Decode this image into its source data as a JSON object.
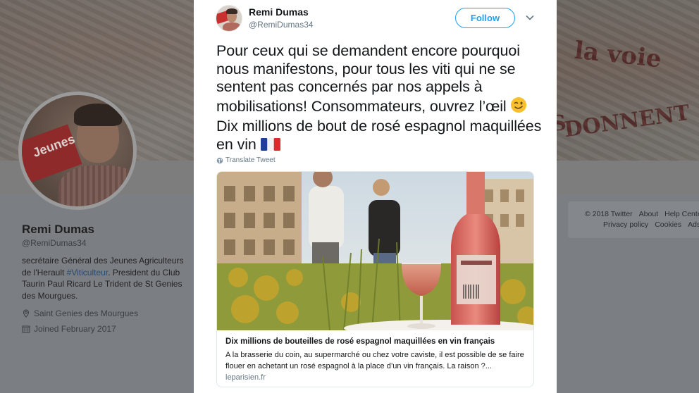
{
  "background_profile": {
    "banner_words": [
      "la voie",
      "DONNENT",
      "S"
    ],
    "avatar_banner_text": "Jeunes",
    "name": "Remi Dumas",
    "handle": "@RemiDumas34",
    "bio_before_tag": "secrétaire Général des Jeunes Agriculteurs de l'Herault ",
    "bio_tag": "#Viticulteur",
    "bio_after_tag": ". President du Club Taurin Paul Ricard Le Trident de St Genies des Mourgues.",
    "location": "Saint Genies des Mourgues",
    "joined": "Joined February 2017",
    "footer": {
      "row1": [
        "© 2018 Twitter",
        "About",
        "Help Center"
      ],
      "row2": [
        "Privacy policy",
        "Cookies",
        "Ads info"
      ]
    }
  },
  "tweet": {
    "author_name": "Remi Dumas",
    "author_handle": "@RemiDumas34",
    "follow_label": "Follow",
    "text_part1": "Pour ceux qui se demandent encore pourquoi nous manifestons, pour tous les viti qui ne se sentent pas concernés par nos appels à mobilisations! Consommateurs, ouvrez l’œil ",
    "text_part2": " Dix millions de bout de rosé espagnol maquillées en vin ",
    "emoji_wink": "wink-emoji",
    "emoji_flag": "france-flag-emoji",
    "translate_label": "Translate Tweet",
    "card": {
      "title": "Dix millions de bouteilles de rosé espagnol maquillées en vin français",
      "description": "A la brasserie du coin, au supermarché ou chez votre caviste, il est possible de se faire flouer en achetant un rosé espagnol à la place d’un vin français. La raison ?...",
      "domain": "leparisien.fr"
    }
  },
  "colors": {
    "accent": "#1da1f2",
    "text_primary": "#14171a",
    "text_secondary": "#657786",
    "border": "#e1e8ed"
  }
}
